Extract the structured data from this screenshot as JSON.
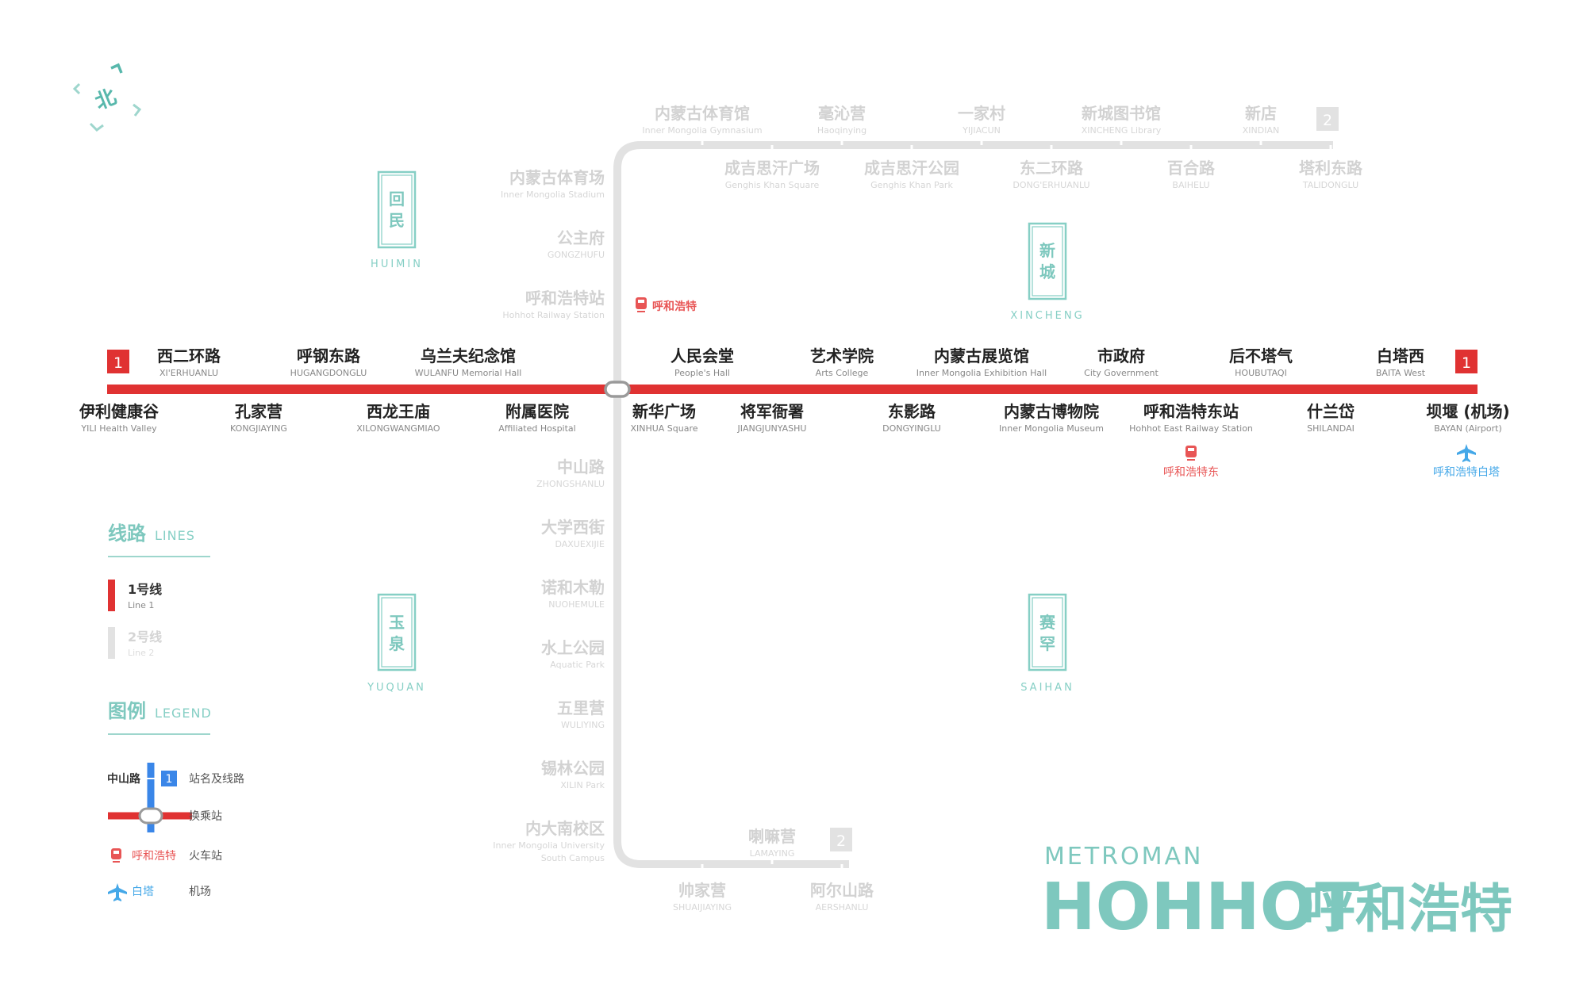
{
  "north_label": "北",
  "line1": {
    "number": "1",
    "color": "#e03232",
    "stations": [
      {
        "cn": "伊利健康谷",
        "en": "YILI Health Valley",
        "pos": "below"
      },
      {
        "cn": "西二环路",
        "en": "XI'ERHUANLU",
        "pos": "above"
      },
      {
        "cn": "孔家营",
        "en": "KONGJIAYING",
        "pos": "below"
      },
      {
        "cn": "呼钢东路",
        "en": "HUGANGDONGLU",
        "pos": "above"
      },
      {
        "cn": "西龙王庙",
        "en": "XILONGWANGMIAO",
        "pos": "below"
      },
      {
        "cn": "乌兰夫纪念馆",
        "en": "WULANFU Memorial Hall",
        "pos": "above"
      },
      {
        "cn": "附属医院",
        "en": "Affiliated Hospital",
        "pos": "below"
      },
      {
        "cn": "新华广场",
        "en": "XINHUA Square",
        "pos": "below"
      },
      {
        "cn": "人民会堂",
        "en": "People's Hall",
        "pos": "above"
      },
      {
        "cn": "将军衙署",
        "en": "JIANGJUNYASHU",
        "pos": "below"
      },
      {
        "cn": "艺术学院",
        "en": "Arts College",
        "pos": "above"
      },
      {
        "cn": "东影路",
        "en": "DONGYINGLU",
        "pos": "below"
      },
      {
        "cn": "内蒙古展览馆",
        "en": "Inner Mongolia Exhibition Hall",
        "pos": "above"
      },
      {
        "cn": "内蒙古博物院",
        "en": "Inner Mongolia Museum",
        "pos": "below"
      },
      {
        "cn": "市政府",
        "en": "City Government",
        "pos": "above"
      },
      {
        "cn": "呼和浩特东站",
        "en": "Hohhot East Railway Station",
        "pos": "below"
      },
      {
        "cn": "后不塔气",
        "en": "HOUBUTAQI",
        "pos": "above"
      },
      {
        "cn": "什兰岱",
        "en": "SHILANDAI",
        "pos": "below"
      },
      {
        "cn": "白塔西",
        "en": "BAITA West",
        "pos": "above"
      },
      {
        "cn": "坝堰 (机场)",
        "en": "BAYAN (Airport)",
        "pos": "below"
      }
    ]
  },
  "line2": {
    "number": "2",
    "color": "#dcdcdc",
    "north_stations": [
      {
        "cn": "内蒙古体育馆",
        "en": "Inner Mongolia Gymnasium",
        "pos": "above"
      },
      {
        "cn": "成吉思汗广场",
        "en": "Genghis Khan Square",
        "pos": "below"
      },
      {
        "cn": "毫沁营",
        "en": "Haoqinying",
        "pos": "above"
      },
      {
        "cn": "成吉思汗公园",
        "en": "Genghis Khan Park",
        "pos": "below"
      },
      {
        "cn": "一家村",
        "en": "YIJIACUN",
        "pos": "above"
      },
      {
        "cn": "东二环路",
        "en": "DONG'ERHUANLU",
        "pos": "below"
      },
      {
        "cn": "新城图书馆",
        "en": "XINCHENG Library",
        "pos": "above"
      },
      {
        "cn": "百合路",
        "en": "BAIHELU",
        "pos": "below"
      },
      {
        "cn": "新店",
        "en": "XINDIAN",
        "pos": "above"
      },
      {
        "cn": "塔利东路",
        "en": "TALIDONGLU",
        "pos": "below"
      }
    ],
    "vertical_stations": [
      {
        "cn": "内蒙古体育场",
        "en": "Inner Mongolia Stadium"
      },
      {
        "cn": "公主府",
        "en": "GONGZHUFU"
      },
      {
        "cn": "呼和浩特站",
        "en": "Hohhot Railway Station"
      },
      {
        "cn": "中山路",
        "en": "ZHONGSHANLU"
      },
      {
        "cn": "大学西街",
        "en": "DAXUEXIJIE"
      },
      {
        "cn": "诺和木勒",
        "en": "NUOHEMULE"
      },
      {
        "cn": "水上公园",
        "en": "Aquatic Park"
      },
      {
        "cn": "五里营",
        "en": "WULIYING"
      },
      {
        "cn": "锡林公园",
        "en": "XILIN Park"
      },
      {
        "cn": "内大南校区",
        "en": "Inner Mongolia University",
        "en2": "South Campus"
      }
    ],
    "south_stations": [
      {
        "cn": "帅家营",
        "en": "SHUAIJIAYING",
        "pos": "below"
      },
      {
        "cn": "喇嘛营",
        "en": "LAMAYING",
        "pos": "above"
      },
      {
        "cn": "阿尔山路",
        "en": "AERSHANLU",
        "pos": "below"
      }
    ]
  },
  "railway_hohhot": "呼和浩特",
  "railway_east": "呼和浩特东",
  "airport_label": "呼和浩特白塔",
  "districts": [
    {
      "c1": "回",
      "c2": "民",
      "en": "HUIMIN"
    },
    {
      "c1": "新",
      "c2": "城",
      "en": "XINCHENG"
    },
    {
      "c1": "玉",
      "c2": "泉",
      "en": "YUQUAN"
    },
    {
      "c1": "赛",
      "c2": "罕",
      "en": "SAIHAN"
    }
  ],
  "legend": {
    "lines_cn": "线路",
    "lines_en": "LINES",
    "line1_cn": "1号线",
    "line1_en": "Line 1",
    "line2_cn": "2号线",
    "line2_en": "Line 2",
    "legend_cn": "图例",
    "legend_en": "LEGEND",
    "sample_station": "中山路",
    "sample_line_number": "1",
    "station_line_label": "站名及线路",
    "interchange_label": "换乘站",
    "railway_sample": "呼和浩特",
    "railway_label": "火车站",
    "airport_sample": "白塔",
    "airport_label": "机场",
    "sample_line_color": "#3a86e8"
  },
  "brand": {
    "small": "METROMAN",
    "big_en": "HOHHOT",
    "big_cn": "呼和浩特",
    "color": "#7ec8be"
  },
  "colors": {
    "teal": "#7ec8be",
    "railway_red": "#e85555",
    "airport_blue": "#45a8e8",
    "faded_text": "#d2d2d2"
  }
}
